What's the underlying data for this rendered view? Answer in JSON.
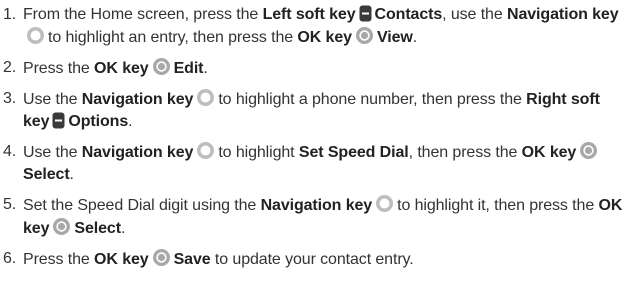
{
  "steps": [
    {
      "num": "1.",
      "parts": [
        {
          "t": "From the Home screen, press the "
        },
        {
          "k": "Left soft key"
        },
        {
          "icon": "soft-key"
        },
        {
          "k": "Contacts"
        },
        {
          "t": ", use the "
        },
        {
          "k": "Navigation key"
        },
        {
          "icon": "nav-key"
        },
        {
          "t": "to highlight an entry, then press the "
        },
        {
          "k": "OK key"
        },
        {
          "icon": "ok-key"
        },
        {
          "k": "View"
        },
        {
          "t": "."
        }
      ]
    },
    {
      "num": "2.",
      "parts": [
        {
          "t": "Press the "
        },
        {
          "k": "OK key"
        },
        {
          "icon": "ok-key"
        },
        {
          "k": "Edit"
        },
        {
          "t": "."
        }
      ]
    },
    {
      "num": "3.",
      "parts": [
        {
          "t": "Use the "
        },
        {
          "k": "Navigation key"
        },
        {
          "icon": "nav-key"
        },
        {
          "t": "to highlight a phone number, then press the "
        },
        {
          "k": "Right soft key"
        },
        {
          "icon": "soft-key"
        },
        {
          "k": "Options"
        },
        {
          "t": "."
        }
      ]
    },
    {
      "num": "4.",
      "parts": [
        {
          "t": "Use the "
        },
        {
          "k": "Navigation key"
        },
        {
          "icon": "nav-key"
        },
        {
          "t": "to highlight "
        },
        {
          "k": "Set Speed Dial"
        },
        {
          "t": ", then press the "
        },
        {
          "k": "OK key"
        },
        {
          "icon": "ok-key"
        },
        {
          "k": "Select"
        },
        {
          "t": "."
        }
      ]
    },
    {
      "num": "5.",
      "parts": [
        {
          "t": "Set the Speed Dial digit using the "
        },
        {
          "k": "Navigation key"
        },
        {
          "icon": "nav-key"
        },
        {
          "t": "to highlight it, then press the "
        },
        {
          "k": "OK key"
        },
        {
          "icon": "ok-key"
        },
        {
          "k": "Select"
        },
        {
          "t": "."
        }
      ]
    },
    {
      "num": "6.",
      "parts": [
        {
          "t": "Press the "
        },
        {
          "k": "OK key"
        },
        {
          "icon": "ok-key"
        },
        {
          "k": "Save"
        },
        {
          "t": " to update your contact entry."
        }
      ]
    }
  ],
  "colors": {
    "text": "#333333",
    "key_text": "#222222",
    "soft_key_fill": "#3a3a3a",
    "nav_key_fill": "#bdbdbd",
    "ok_key_fill": "#a8a8a8"
  }
}
